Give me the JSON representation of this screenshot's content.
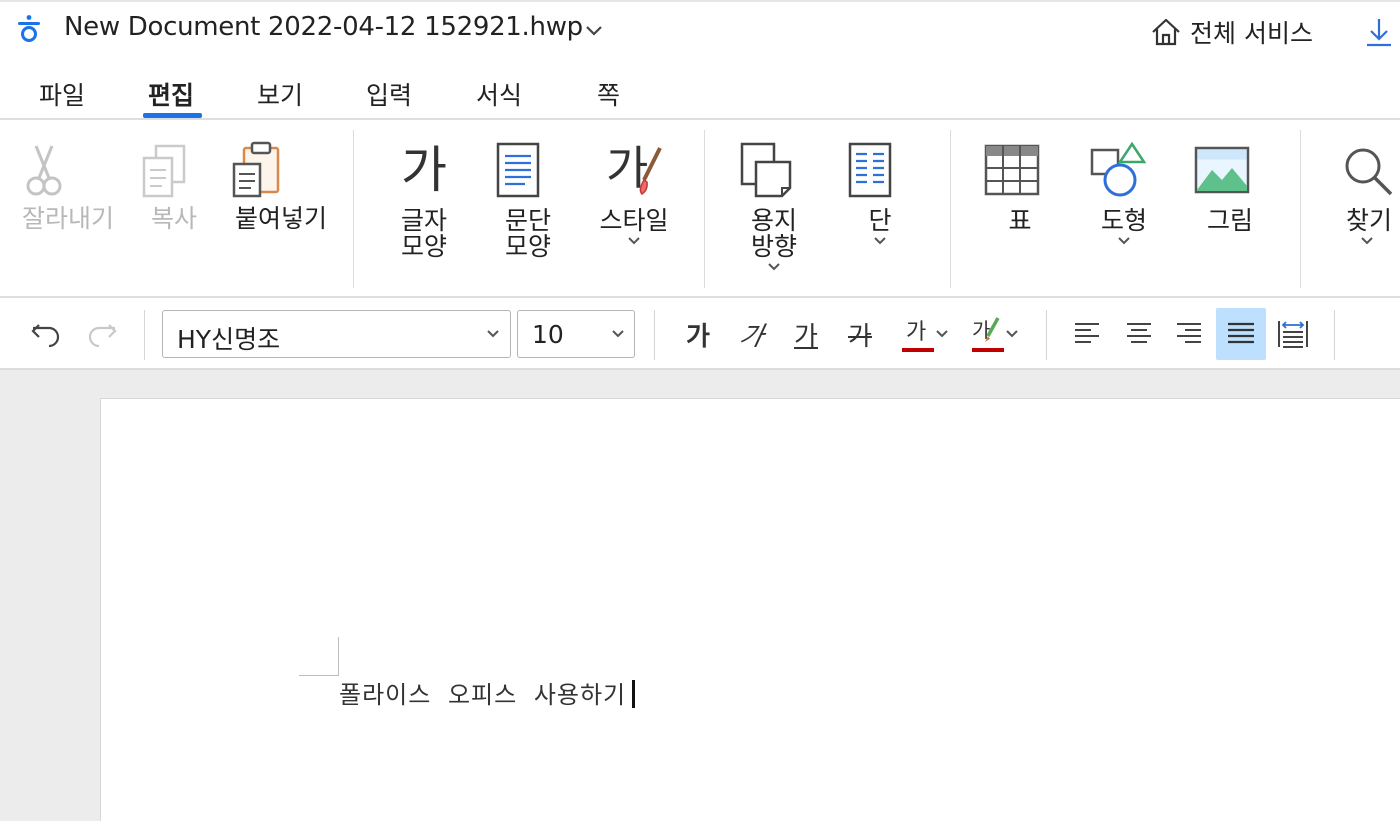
{
  "title_bar": {
    "doc_title": "New Document 2022-04-12 152921.hwp",
    "all_services": "전체 서비스"
  },
  "menu": {
    "tabs": [
      {
        "label": "파일"
      },
      {
        "label": "편집",
        "active": true
      },
      {
        "label": "보기"
      },
      {
        "label": "입력"
      },
      {
        "label": "서식"
      },
      {
        "label": "쪽"
      }
    ]
  },
  "ribbon": {
    "cut": "잘라내기",
    "copy": "복사",
    "paste": "붙여넣기",
    "char_shape_1": "글자",
    "char_shape_2": "모양",
    "para_shape_1": "문단",
    "para_shape_2": "모양",
    "style": "스타일",
    "style_glyph": "가",
    "char_glyph": "가",
    "orientation_1": "용지",
    "orientation_2": "방향",
    "columns": "단",
    "table": "표",
    "shape": "도형",
    "picture": "그림",
    "find": "찾기"
  },
  "format_bar": {
    "font": "HY신명조",
    "size": "10",
    "bold": "가",
    "italic": "가",
    "underline": "가",
    "strike": "가",
    "font_color": "가",
    "highlight": "가",
    "font_color_hex": "#c00000",
    "highlight_hex": "#c00000",
    "active_align": "justify"
  },
  "document": {
    "text": "폴라이스 오피스 사용하기"
  },
  "colors": {
    "accent": "#1a73e8",
    "active_button_bg": "#bde0ff"
  }
}
